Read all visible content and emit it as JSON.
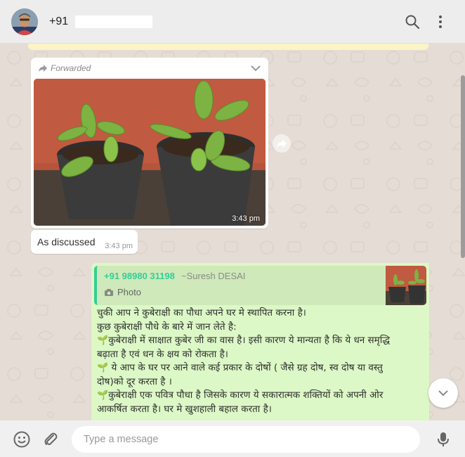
{
  "header": {
    "contact_prefix": "+91"
  },
  "chat": {
    "forwarded_message": {
      "forwarded_label": "Forwarded",
      "time": "3:43 pm"
    },
    "caption_message": {
      "text": "As discussed",
      "time": "3:43 pm"
    },
    "outgoing_message": {
      "quote": {
        "sender": "+91 98980 31198",
        "alias": "~Suresh DESAI",
        "type_label": "Photo"
      },
      "lines": [
        "चुकी आप ने कुबेराक्षी का पौधा अपने घर मे स्थापित करना है।",
        "कुछ कुबेराक्षी पौधे के बारे में जान लेते है:",
        "कुबेराक्षी में साक्षात कुबेर जी का वास है। इसी कारण ये मान्यता है कि ये धन समृद्धि",
        "बढ़ाता है एवं धन के क्षय को रोकता है।",
        " ये आप के घर पर आने वाले कई प्रकार के दोषों ( जैसे ग्रह दोष, स्व दोष या वस्तु",
        "दोष)को दूर करता है ।",
        "कुबेराक्षी एक पवित्र पौधा है जिसके कारण ये सकारात्मक शक्तियों को अपनी ओर",
        "आकर्षित करता है। घर मे खुशहाली बहाल करता है।"
      ]
    }
  },
  "composer": {
    "placeholder": "Type a message"
  },
  "colors": {
    "outgoing_bubble": "#dcf8c6",
    "quote_accent": "#35cd96",
    "chat_background": "#e5ddd5"
  }
}
